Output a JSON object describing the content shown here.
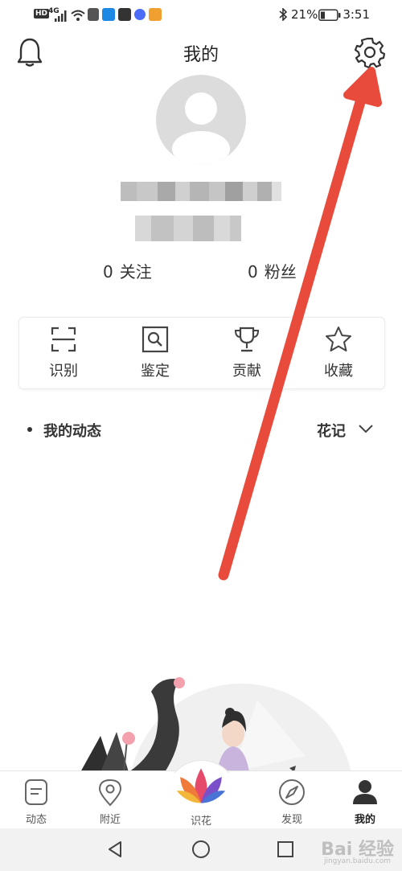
{
  "status_bar": {
    "network_badge": "HD",
    "network_type": "4G",
    "battery_percent": "21%",
    "time": "3:51",
    "bluetooth_icon": "bluetooth-icon"
  },
  "header": {
    "title": "我的",
    "left_icon": "bell-icon",
    "right_icon": "gear-icon"
  },
  "profile": {
    "following_count": "0",
    "following_label": "关注",
    "followers_count": "0",
    "followers_label": "粉丝"
  },
  "quick_actions": [
    {
      "label": "识别",
      "icon": "scan-icon"
    },
    {
      "label": "鉴定",
      "icon": "search-square-icon"
    },
    {
      "label": "贡献",
      "icon": "trophy-icon"
    },
    {
      "label": "收藏",
      "icon": "star-icon"
    }
  ],
  "feed": {
    "title": "我的动态",
    "filter_value": "花记"
  },
  "bottom_nav": [
    {
      "label": "动态",
      "icon": "note-icon"
    },
    {
      "label": "附近",
      "icon": "location-pin-icon"
    },
    {
      "label": "识花",
      "icon": "lotus-icon"
    },
    {
      "label": "发现",
      "icon": "compass-icon"
    },
    {
      "label": "我的",
      "icon": "person-icon",
      "active": true
    }
  ],
  "watermark": {
    "text": "Bai 经验",
    "sub": "jingyan.baidu.com"
  },
  "colors": {
    "accent_arrow": "#e84a3c",
    "avatar_bg": "#dcdcdc",
    "text_primary": "#222222"
  }
}
